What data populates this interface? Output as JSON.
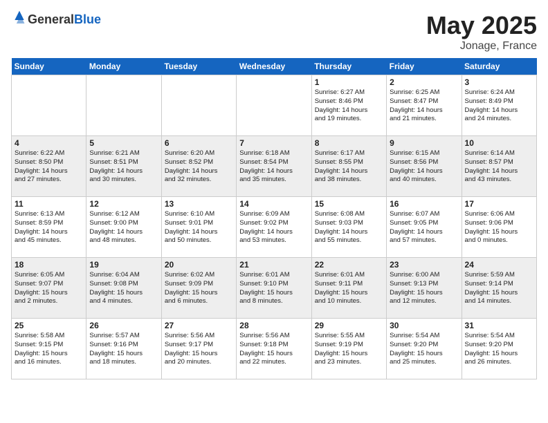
{
  "header": {
    "logo_general": "General",
    "logo_blue": "Blue",
    "title": "May 2025",
    "location": "Jonage, France"
  },
  "weekdays": [
    "Sunday",
    "Monday",
    "Tuesday",
    "Wednesday",
    "Thursday",
    "Friday",
    "Saturday"
  ],
  "weeks": [
    [
      {
        "day": "",
        "info": ""
      },
      {
        "day": "",
        "info": ""
      },
      {
        "day": "",
        "info": ""
      },
      {
        "day": "",
        "info": ""
      },
      {
        "day": "1",
        "info": "Sunrise: 6:27 AM\nSunset: 8:46 PM\nDaylight: 14 hours\nand 19 minutes."
      },
      {
        "day": "2",
        "info": "Sunrise: 6:25 AM\nSunset: 8:47 PM\nDaylight: 14 hours\nand 21 minutes."
      },
      {
        "day": "3",
        "info": "Sunrise: 6:24 AM\nSunset: 8:49 PM\nDaylight: 14 hours\nand 24 minutes."
      }
    ],
    [
      {
        "day": "4",
        "info": "Sunrise: 6:22 AM\nSunset: 8:50 PM\nDaylight: 14 hours\nand 27 minutes."
      },
      {
        "day": "5",
        "info": "Sunrise: 6:21 AM\nSunset: 8:51 PM\nDaylight: 14 hours\nand 30 minutes."
      },
      {
        "day": "6",
        "info": "Sunrise: 6:20 AM\nSunset: 8:52 PM\nDaylight: 14 hours\nand 32 minutes."
      },
      {
        "day": "7",
        "info": "Sunrise: 6:18 AM\nSunset: 8:54 PM\nDaylight: 14 hours\nand 35 minutes."
      },
      {
        "day": "8",
        "info": "Sunrise: 6:17 AM\nSunset: 8:55 PM\nDaylight: 14 hours\nand 38 minutes."
      },
      {
        "day": "9",
        "info": "Sunrise: 6:15 AM\nSunset: 8:56 PM\nDaylight: 14 hours\nand 40 minutes."
      },
      {
        "day": "10",
        "info": "Sunrise: 6:14 AM\nSunset: 8:57 PM\nDaylight: 14 hours\nand 43 minutes."
      }
    ],
    [
      {
        "day": "11",
        "info": "Sunrise: 6:13 AM\nSunset: 8:59 PM\nDaylight: 14 hours\nand 45 minutes."
      },
      {
        "day": "12",
        "info": "Sunrise: 6:12 AM\nSunset: 9:00 PM\nDaylight: 14 hours\nand 48 minutes."
      },
      {
        "day": "13",
        "info": "Sunrise: 6:10 AM\nSunset: 9:01 PM\nDaylight: 14 hours\nand 50 minutes."
      },
      {
        "day": "14",
        "info": "Sunrise: 6:09 AM\nSunset: 9:02 PM\nDaylight: 14 hours\nand 53 minutes."
      },
      {
        "day": "15",
        "info": "Sunrise: 6:08 AM\nSunset: 9:03 PM\nDaylight: 14 hours\nand 55 minutes."
      },
      {
        "day": "16",
        "info": "Sunrise: 6:07 AM\nSunset: 9:05 PM\nDaylight: 14 hours\nand 57 minutes."
      },
      {
        "day": "17",
        "info": "Sunrise: 6:06 AM\nSunset: 9:06 PM\nDaylight: 15 hours\nand 0 minutes."
      }
    ],
    [
      {
        "day": "18",
        "info": "Sunrise: 6:05 AM\nSunset: 9:07 PM\nDaylight: 15 hours\nand 2 minutes."
      },
      {
        "day": "19",
        "info": "Sunrise: 6:04 AM\nSunset: 9:08 PM\nDaylight: 15 hours\nand 4 minutes."
      },
      {
        "day": "20",
        "info": "Sunrise: 6:02 AM\nSunset: 9:09 PM\nDaylight: 15 hours\nand 6 minutes."
      },
      {
        "day": "21",
        "info": "Sunrise: 6:01 AM\nSunset: 9:10 PM\nDaylight: 15 hours\nand 8 minutes."
      },
      {
        "day": "22",
        "info": "Sunrise: 6:01 AM\nSunset: 9:11 PM\nDaylight: 15 hours\nand 10 minutes."
      },
      {
        "day": "23",
        "info": "Sunrise: 6:00 AM\nSunset: 9:13 PM\nDaylight: 15 hours\nand 12 minutes."
      },
      {
        "day": "24",
        "info": "Sunrise: 5:59 AM\nSunset: 9:14 PM\nDaylight: 15 hours\nand 14 minutes."
      }
    ],
    [
      {
        "day": "25",
        "info": "Sunrise: 5:58 AM\nSunset: 9:15 PM\nDaylight: 15 hours\nand 16 minutes."
      },
      {
        "day": "26",
        "info": "Sunrise: 5:57 AM\nSunset: 9:16 PM\nDaylight: 15 hours\nand 18 minutes."
      },
      {
        "day": "27",
        "info": "Sunrise: 5:56 AM\nSunset: 9:17 PM\nDaylight: 15 hours\nand 20 minutes."
      },
      {
        "day": "28",
        "info": "Sunrise: 5:56 AM\nSunset: 9:18 PM\nDaylight: 15 hours\nand 22 minutes."
      },
      {
        "day": "29",
        "info": "Sunrise: 5:55 AM\nSunset: 9:19 PM\nDaylight: 15 hours\nand 23 minutes."
      },
      {
        "day": "30",
        "info": "Sunrise: 5:54 AM\nSunset: 9:20 PM\nDaylight: 15 hours\nand 25 minutes."
      },
      {
        "day": "31",
        "info": "Sunrise: 5:54 AM\nSunset: 9:20 PM\nDaylight: 15 hours\nand 26 minutes."
      }
    ]
  ]
}
